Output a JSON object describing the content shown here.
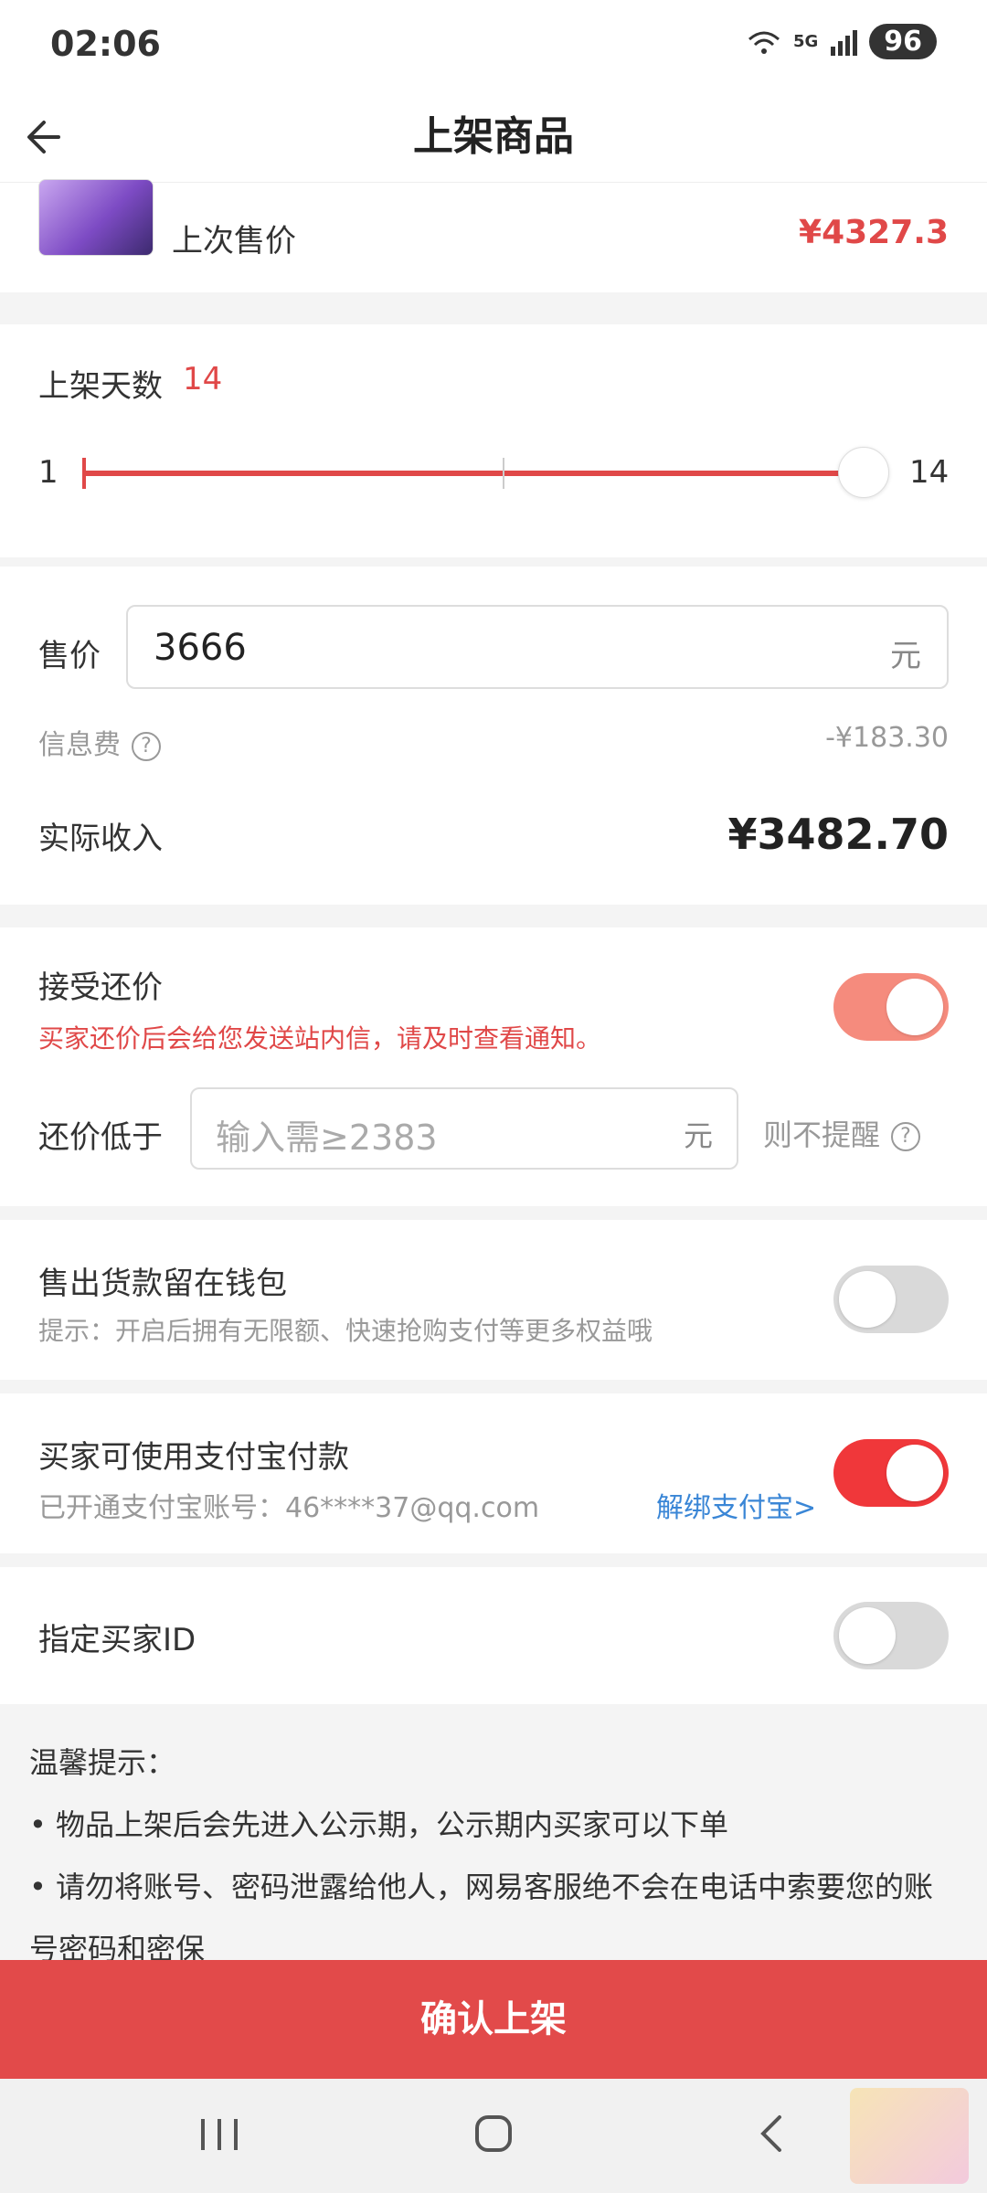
{
  "status_bar": {
    "time": "02:06",
    "network": "5G",
    "battery": "96"
  },
  "nav": {
    "title": "上架商品"
  },
  "last_price": {
    "label": "上次售价",
    "value": "¥4327.3"
  },
  "days": {
    "label": "上架天数",
    "value": "14",
    "min": "1",
    "max": "14",
    "progress": 1.0
  },
  "price": {
    "label": "售价",
    "input_value": "3666",
    "unit": "元",
    "fee_label": "信息费",
    "fee_value": "-¥183.30",
    "income_label": "实际收入",
    "income_value": "¥3482.70"
  },
  "counter_offer": {
    "title": "接受还价",
    "note": "买家还价后会给您发送站内信，请及时查看通知。",
    "enabled": true,
    "low_label": "还价低于",
    "placeholder": "输入需≥2383",
    "unit": "元",
    "suffix": "则不提醒"
  },
  "wallet": {
    "title": "售出货款留在钱包",
    "hint": "提示：开启后拥有无限额、快速抢购支付等更多权益哦",
    "enabled": false
  },
  "alipay": {
    "title": "买家可使用支付宝付款",
    "account": "已开通支付宝账号：46****37@qq.com",
    "unbind": "解绑支付宝>",
    "enabled": true
  },
  "buyer_id": {
    "title": "指定买家ID",
    "enabled": false
  },
  "tips": {
    "title": "温馨提示：",
    "items": [
      "• 物品上架后会先进入公示期，公示期内买家可以下单",
      "• 请勿将账号、密码泄露给他人，网易客服绝不会在电话中索要您的账号密码和密保"
    ]
  },
  "confirm_button": "确认上架",
  "colors": {
    "accent": "#e24a4a",
    "link": "#3a86d6",
    "toggle_on": "#f0373a"
  }
}
